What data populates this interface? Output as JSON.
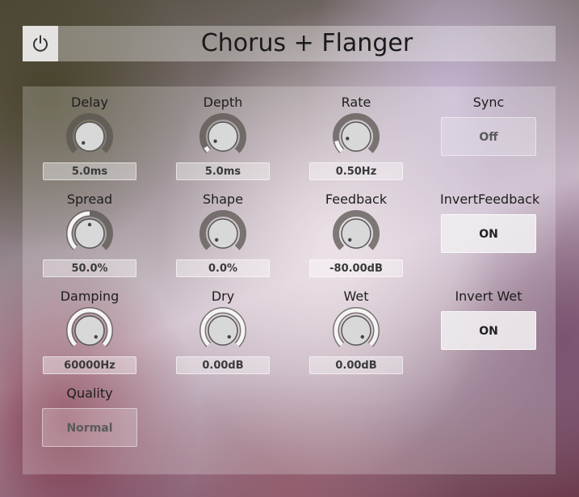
{
  "title": "Chorus + Flanger",
  "power": {
    "icon": "power-icon"
  },
  "knobs": [
    {
      "id": "delay",
      "label": "Delay",
      "value": "5.0ms",
      "level": 0.0
    },
    {
      "id": "depth",
      "label": "Depth",
      "value": "5.0ms",
      "level": 0.05
    },
    {
      "id": "rate",
      "label": "Rate",
      "value": "0.50Hz",
      "level": 0.12
    },
    {
      "id": "spread",
      "label": "Spread",
      "value": "50.0%",
      "level": 0.5
    },
    {
      "id": "shape",
      "label": "Shape",
      "value": "0.0%",
      "level": 0.0
    },
    {
      "id": "feedback",
      "label": "Feedback",
      "value": "-80.00dB",
      "level": 0.0
    },
    {
      "id": "damping",
      "label": "Damping",
      "value": "60000Hz",
      "level": 1.0
    },
    {
      "id": "dry",
      "label": "Dry",
      "value": "0.00dB",
      "level": 1.0
    },
    {
      "id": "wet",
      "label": "Wet",
      "value": "0.00dB",
      "level": 1.0
    }
  ],
  "toggles": [
    {
      "id": "sync",
      "label": "Sync",
      "value": "Off",
      "on": false
    },
    {
      "id": "invert-feedback",
      "label": "InvertFeedback",
      "value": "ON",
      "on": true
    },
    {
      "id": "invert-wet",
      "label": "Invert Wet",
      "value": "ON",
      "on": true
    }
  ],
  "quality": {
    "label": "Quality",
    "value": "Normal"
  },
  "colors": {
    "knob_track": "#5a5550",
    "knob_fill": "#f4f4f4",
    "knob_body": "#d8d8d8"
  }
}
